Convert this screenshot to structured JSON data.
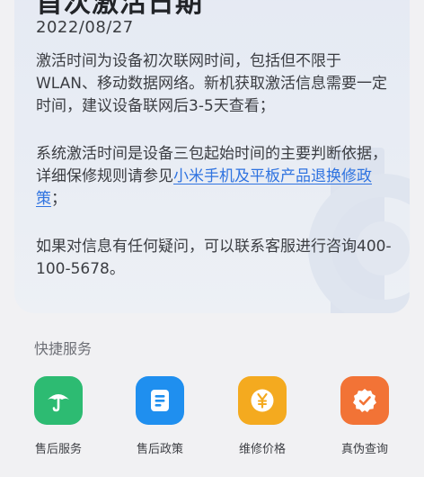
{
  "card": {
    "title": "首次激活日期",
    "date": "2022/08/27",
    "paragraph1": "激活时间为设备初次联网时间，包括但不限于WLAN、移动数据网络。新机获取激活信息需要一定时间，建议设备联网后3-5天查看；",
    "paragraph2_prefix": "系统激活时间是设备三包起始时间的主要判断依据，详细保修规则请参见",
    "paragraph2_link": "小米手机及平板产品退换修政策",
    "paragraph2_suffix": "；",
    "paragraph3": "如果对信息有任何疑问，可以联系客服进行咨询400-100-5678。"
  },
  "quick_services": {
    "title": "快捷服务",
    "items": [
      {
        "label": "售后服务",
        "icon": "umbrella-icon",
        "color": "#2dbb72"
      },
      {
        "label": "售后政策",
        "icon": "document-icon",
        "color": "#1f8fef"
      },
      {
        "label": "维修价格",
        "icon": "yen-coin-icon",
        "color": "#f4aa1f"
      },
      {
        "label": "真伪查询",
        "icon": "verified-badge-icon",
        "color": "#f27336"
      }
    ]
  }
}
